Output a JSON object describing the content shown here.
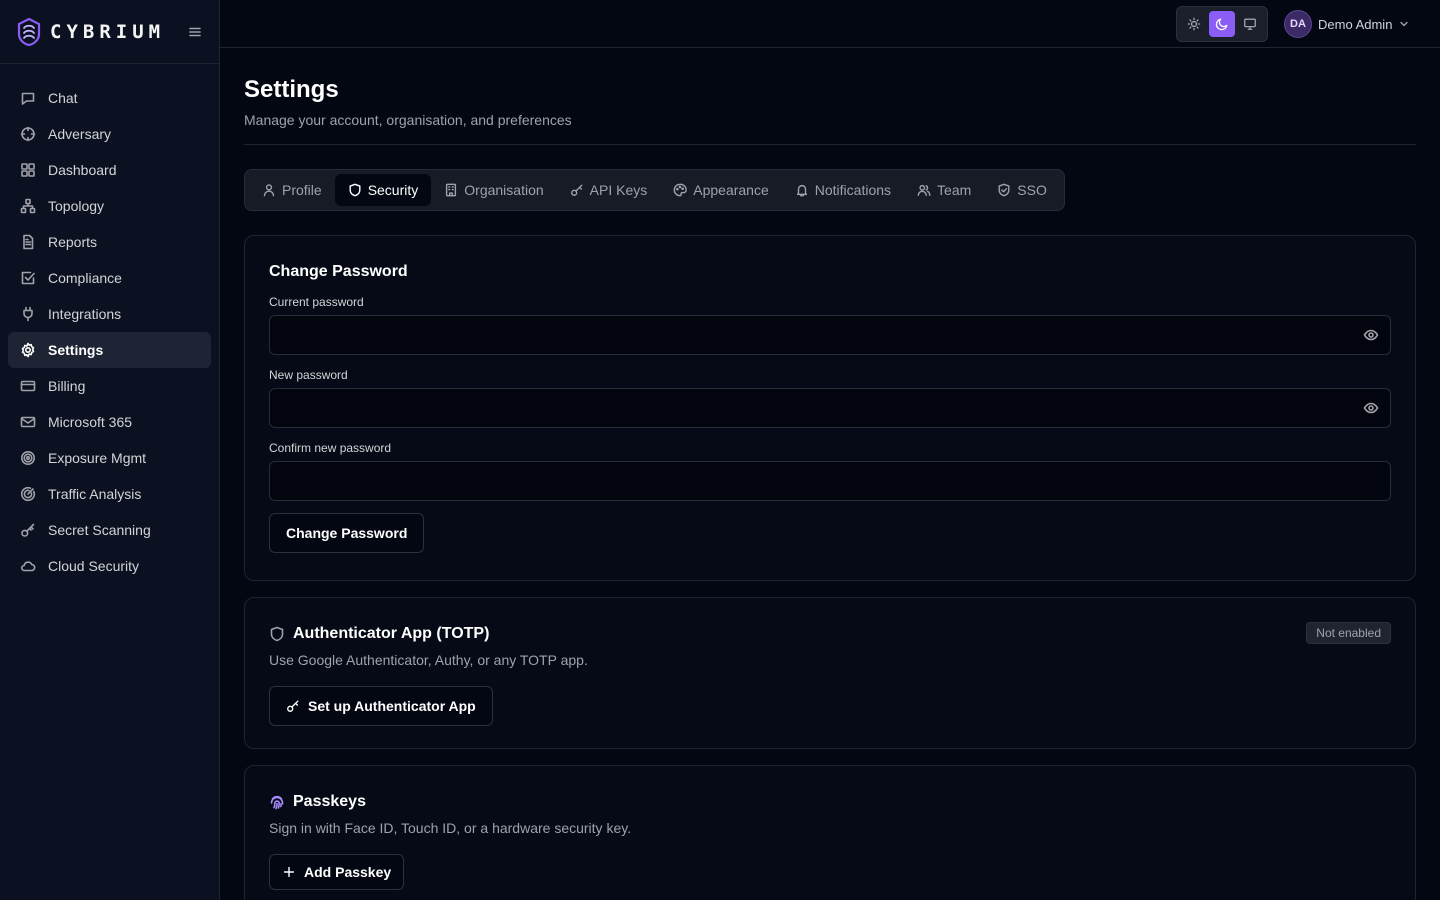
{
  "brand": {
    "name": "CYBRIUM",
    "accent": "#8b5cf6"
  },
  "sidebar": {
    "items": [
      {
        "label": "Chat",
        "icon": "message-square-icon"
      },
      {
        "label": "Adversary",
        "icon": "crosshair-icon"
      },
      {
        "label": "Dashboard",
        "icon": "grid-icon"
      },
      {
        "label": "Topology",
        "icon": "network-icon"
      },
      {
        "label": "Reports",
        "icon": "file-text-icon"
      },
      {
        "label": "Compliance",
        "icon": "check-square-icon"
      },
      {
        "label": "Integrations",
        "icon": "plug-icon"
      },
      {
        "label": "Settings",
        "icon": "gear-icon",
        "active": true
      },
      {
        "label": "Billing",
        "icon": "credit-card-icon"
      },
      {
        "label": "Microsoft 365",
        "icon": "mail-icon"
      },
      {
        "label": "Exposure Mgmt",
        "icon": "target-icon"
      },
      {
        "label": "Traffic Analysis",
        "icon": "radar-icon"
      },
      {
        "label": "Secret Scanning",
        "icon": "key-icon"
      },
      {
        "label": "Cloud Security",
        "icon": "cloud-icon"
      }
    ]
  },
  "topbar": {
    "theme_options": [
      "light",
      "dark",
      "system"
    ],
    "theme_selected": "dark",
    "user": {
      "initials": "DA",
      "name": "Demo Admin"
    }
  },
  "page": {
    "title": "Settings",
    "subtitle": "Manage your account, organisation, and preferences"
  },
  "tabs": [
    {
      "label": "Profile",
      "icon": "user-icon"
    },
    {
      "label": "Security",
      "icon": "shield-icon",
      "active": true
    },
    {
      "label": "Organisation",
      "icon": "building-icon"
    },
    {
      "label": "API Keys",
      "icon": "key-icon"
    },
    {
      "label": "Appearance",
      "icon": "palette-icon"
    },
    {
      "label": "Notifications",
      "icon": "bell-icon"
    },
    {
      "label": "Team",
      "icon": "users-icon"
    },
    {
      "label": "SSO",
      "icon": "shield-check-icon"
    }
  ],
  "change_password": {
    "title": "Change Password",
    "current_label": "Current password",
    "current_value": "",
    "new_label": "New password",
    "new_value": "",
    "confirm_label": "Confirm new password",
    "confirm_value": "",
    "button": "Change Password"
  },
  "totp": {
    "title": "Authenticator App (TOTP)",
    "description": "Use Google Authenticator, Authy, or any TOTP app.",
    "status": "Not enabled",
    "button": "Set up Authenticator App"
  },
  "passkeys": {
    "title": "Passkeys",
    "description": "Sign in with Face ID, Touch ID, or a hardware security key.",
    "button": "Add Passkey"
  }
}
